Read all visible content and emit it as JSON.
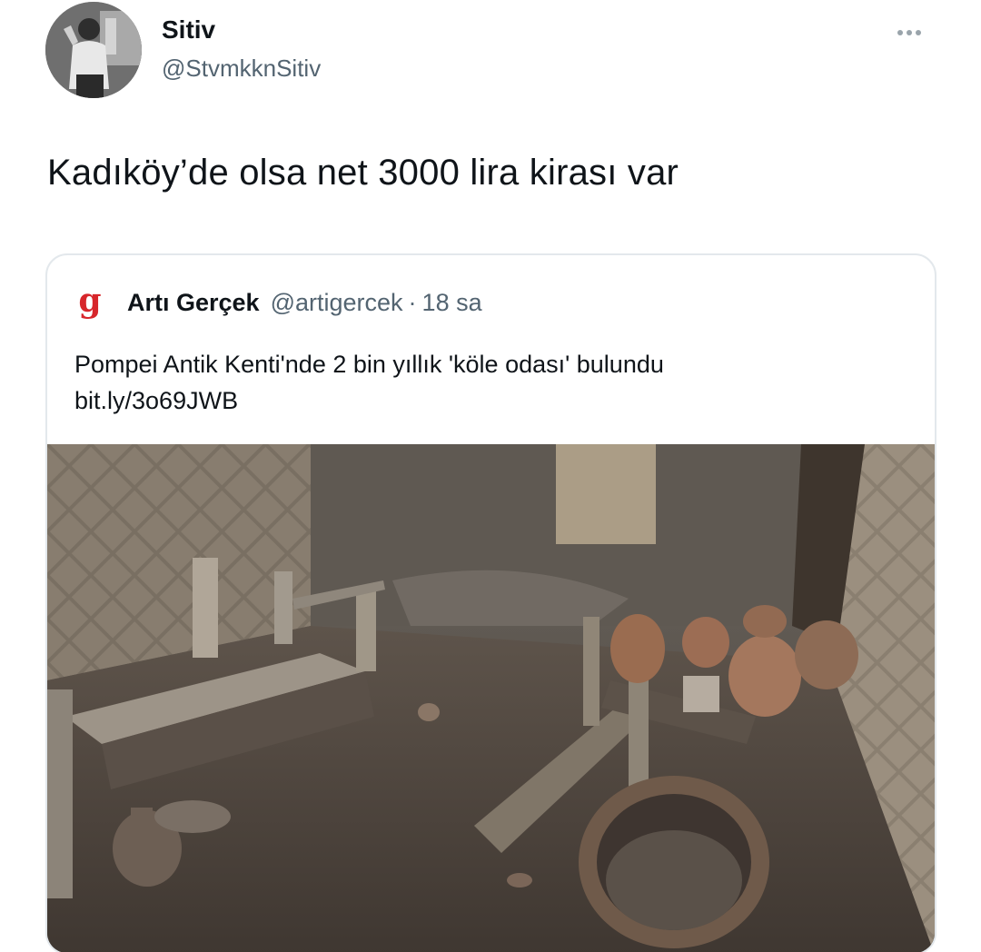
{
  "tweet": {
    "author": {
      "name": "Sitiv",
      "handle": "@StvmkknSitiv",
      "avatar_icon": "profile-avatar"
    },
    "more_icon": "more-horizontal-icon",
    "text": "Kadıköy’de olsa net 3000 lira kirası var"
  },
  "quoted_tweet": {
    "author": {
      "name": "Artı Gerçek",
      "handle": "@artigercek",
      "logo_icon": "arti-gercek-logo",
      "logo_color": "#d7262b"
    },
    "separator": "·",
    "time": "18 sa",
    "text": "Pompei Antik Kenti'nde 2 bin yıllık 'köle odası' bulundu",
    "link": "bit.ly/3o69JWB",
    "media": {
      "type": "photo"
    }
  },
  "colors": {
    "text": "#0f1419",
    "secondary": "#536471",
    "border": "#e3e8ec"
  }
}
